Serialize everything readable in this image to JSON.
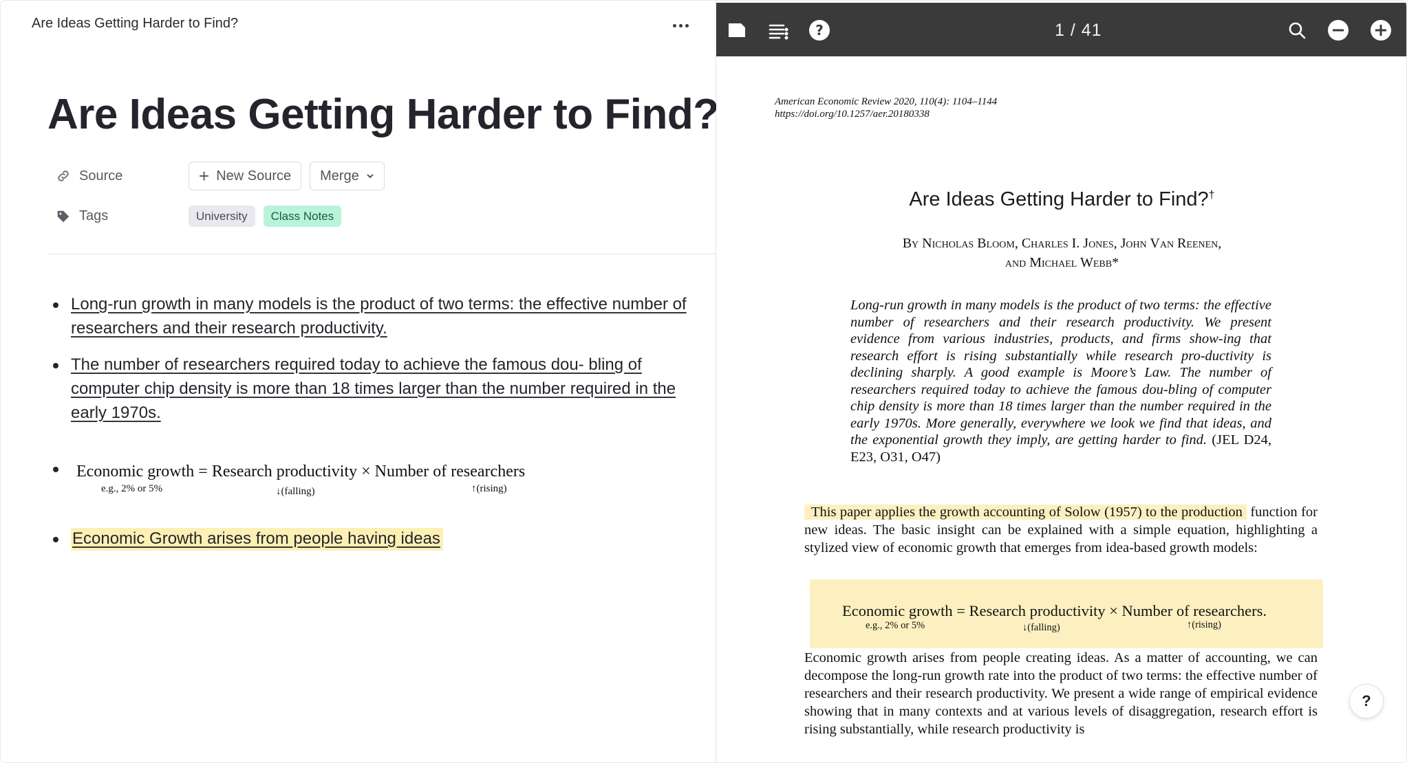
{
  "note": {
    "window_title": "Are Ideas Getting Harder to Find?",
    "title": "Are Ideas Getting Harder to Find?",
    "source_label": "Source",
    "new_source_label": "New Source",
    "merge_label": "Merge",
    "tags_label": "Tags",
    "tags": [
      "University",
      "Class Notes"
    ],
    "bullets": [
      "Long-run growth in many models is the product of two terms: the effective number of researchers and their research productivity.",
      "The number of researchers required today to achieve the famous dou- bling of computer chip density is more than 18 times larger than the number required in the early 1970s.",
      "Economic Growth arises from people having ideas"
    ],
    "equation": {
      "main": "Economic growth  =  Research productivity × Number of researchers",
      "sub_left": "e.g., 2% or 5%",
      "sub_mid": "↓(falling)",
      "sub_right": "↑(rising)"
    }
  },
  "viewer": {
    "page_current": "1",
    "page_total": "41",
    "page_display": "1 / 41",
    "citation_line1": "American Economic Review 2020, 110(4): 1104–1144",
    "citation_line2": "https://doi.org/10.1257/aer.20180338",
    "paper_title": "Are Ideas Getting Harder to Find?",
    "title_mark": "†",
    "authors_line1": "By Nicholas Bloom, Charles I. Jones, John Van Reenen,",
    "authors_line2": "and Michael Webb*",
    "abstract": "Long-run growth in many models is the product of two terms: the effective number of researchers and their research productivity. We present evidence from various industries, products, and firms show-ing that research effort is rising substantially while research pro-ductivity is declining sharply. A good example is Moore’s Law. The number of researchers required today to achieve the famous dou-bling of computer chip density is more than 18 times larger than the number required in the early 1970s. More generally, everywhere we look we find that ideas, and the exponential growth they imply, are getting harder to find.",
    "abstract_jel": "(JEL D24, E23, O31, O47)",
    "body_highlight": "This paper applies the growth accounting of Solow (1957) to the production",
    "body_p1_rest": "function for new ideas. The basic insight can be explained with a simple equation, highlighting a stylized view of economic growth that emerges from idea-based growth models:",
    "equation_main": "Economic growth  =  Research productivity × Number of researchers.",
    "equation_sub_left": "e.g., 2% or 5%",
    "equation_sub_mid": "↓(falling)",
    "equation_sub_right": "↑(rising)",
    "body_p2": "Economic growth arises from people creating ideas. As a matter of accounting, we can decompose the long-run growth rate into the product of two terms: the effective number of researchers and their research productivity. We present a wide range of empirical evidence showing that in many contexts and at various levels of disaggregation, research effort is rising substantially, while research productivity is"
  },
  "help_label": "?",
  "colors": {
    "toolbar": "#3a3a3a",
    "highlight": "#fdf0c0",
    "tag_green": "#b9f3d9",
    "tag_grey": "#e8e8ee"
  }
}
